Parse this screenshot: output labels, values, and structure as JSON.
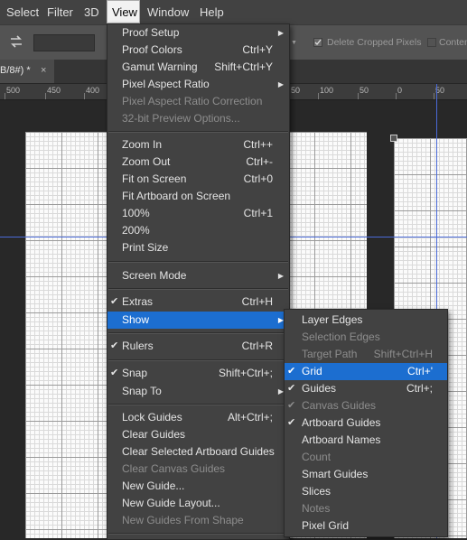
{
  "menubar": {
    "items": [
      "Select",
      "Filter",
      "3D",
      "View",
      "Window",
      "Help"
    ]
  },
  "options": {
    "delete_cropped_label": "Delete Cropped Pixels",
    "content_label": "Conten"
  },
  "document_tab": {
    "title": "B/8#) *",
    "close_glyph": "×"
  },
  "ruler": {
    "labels": [
      "500",
      "450",
      "400",
      "50",
      "100",
      "50",
      "0",
      "50"
    ]
  },
  "view_menu": {
    "items": [
      {
        "label": "Proof Setup",
        "shortcut": "",
        "submenu": true
      },
      {
        "label": "Proof Colors",
        "shortcut": "Ctrl+Y"
      },
      {
        "label": "Gamut Warning",
        "shortcut": "Shift+Ctrl+Y"
      },
      {
        "label": "Pixel Aspect Ratio",
        "shortcut": "",
        "submenu": true
      },
      {
        "label": "Pixel Aspect Ratio Correction",
        "shortcut": "",
        "disabled": true
      },
      {
        "label": "32-bit Preview Options...",
        "shortcut": "",
        "disabled": true
      },
      {
        "label": "Zoom In",
        "shortcut": "Ctrl++"
      },
      {
        "label": "Zoom Out",
        "shortcut": "Ctrl+-"
      },
      {
        "label": "Fit on Screen",
        "shortcut": "Ctrl+0"
      },
      {
        "label": "Fit Artboard on Screen",
        "shortcut": ""
      },
      {
        "label": "100%",
        "shortcut": "Ctrl+1"
      },
      {
        "label": "200%",
        "shortcut": ""
      },
      {
        "label": "Print Size",
        "shortcut": ""
      },
      {
        "label": "Screen Mode",
        "shortcut": "",
        "submenu": true
      },
      {
        "label": "Extras",
        "shortcut": "Ctrl+H",
        "checked": true
      },
      {
        "label": "Show",
        "shortcut": "",
        "submenu": true,
        "highlighted": true
      },
      {
        "label": "Rulers",
        "shortcut": "Ctrl+R",
        "checked": true
      },
      {
        "label": "Snap",
        "shortcut": "Shift+Ctrl+;",
        "checked": true
      },
      {
        "label": "Snap To",
        "shortcut": "",
        "submenu": true
      },
      {
        "label": "Lock Guides",
        "shortcut": "Alt+Ctrl+;"
      },
      {
        "label": "Clear Guides",
        "shortcut": ""
      },
      {
        "label": "Clear Selected Artboard Guides",
        "shortcut": ""
      },
      {
        "label": "Clear Canvas Guides",
        "shortcut": "",
        "disabled": true
      },
      {
        "label": "New Guide...",
        "shortcut": ""
      },
      {
        "label": "New Guide Layout...",
        "shortcut": ""
      },
      {
        "label": "New Guides From Shape",
        "shortcut": "",
        "disabled": true
      }
    ]
  },
  "show_submenu": {
    "items": [
      {
        "label": "Layer Edges",
        "shortcut": ""
      },
      {
        "label": "Selection Edges",
        "shortcut": "",
        "disabled": true
      },
      {
        "label": "Target Path",
        "shortcut": "Shift+Ctrl+H",
        "disabled": true
      },
      {
        "label": "Grid",
        "shortcut": "Ctrl+'",
        "checked": true,
        "highlighted": true
      },
      {
        "label": "Guides",
        "shortcut": "Ctrl+;",
        "checked": true
      },
      {
        "label": "Canvas Guides",
        "shortcut": "",
        "checked": true,
        "disabled": true
      },
      {
        "label": "Artboard Guides",
        "shortcut": "",
        "checked": true
      },
      {
        "label": "Artboard Names",
        "shortcut": ""
      },
      {
        "label": "Count",
        "shortcut": "",
        "disabled": true
      },
      {
        "label": "Smart Guides",
        "shortcut": ""
      },
      {
        "label": "Slices",
        "shortcut": ""
      },
      {
        "label": "Notes",
        "shortcut": "",
        "disabled": true
      },
      {
        "label": "Pixel Grid",
        "shortcut": ""
      }
    ]
  },
  "glyphs": {
    "check": "✔",
    "submenu_arrow": "▶"
  },
  "colors": {
    "highlight": "#1c6ed0",
    "menu_bg": "#424242",
    "guide": "#4a6ad8"
  }
}
